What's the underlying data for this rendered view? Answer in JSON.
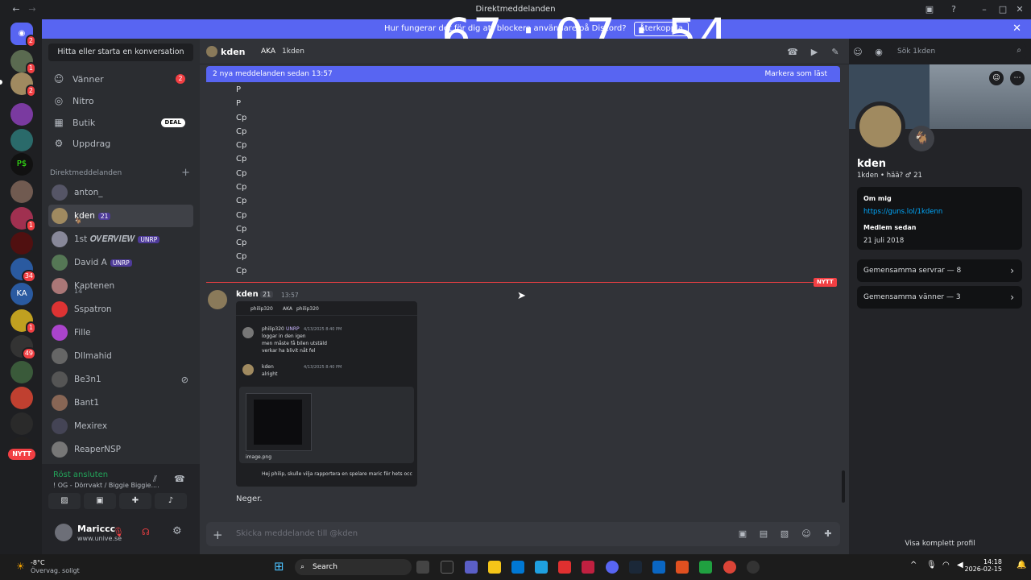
{
  "window": {
    "title": "Direktmeddelanden"
  },
  "overlay_clock": "67 : 07 : 54",
  "banner": {
    "text": "Hur fungerar det för dig att blockera användare på Discord?",
    "button": "Återkoppla"
  },
  "servers": {
    "badges": [
      "2",
      "1",
      "2",
      "1",
      "2",
      "34",
      "1",
      "49"
    ],
    "ka_label": "KA",
    "new_pill": "NYTT"
  },
  "dm_sidebar": {
    "search_placeholder": "Hitta eller starta en konversation",
    "nav": [
      {
        "label": "Vänner",
        "badge": "2"
      },
      {
        "label": "Nitro"
      },
      {
        "label": "Butik",
        "badge": "DEAL"
      },
      {
        "label": "Uppdrag"
      }
    ],
    "dm_header": "Direktmeddelanden",
    "dms": [
      {
        "name": "anton_"
      },
      {
        "name": "kden",
        "tag": "21",
        "sub": "🐐"
      },
      {
        "name": "1st 𝑶𝑽𝑬𝑹𝑽𝑰𝑬𝑾",
        "tag": "UNRP"
      },
      {
        "name": "David A",
        "tag": "UNRP"
      },
      {
        "name": "Kaptenen",
        "sub": "14"
      },
      {
        "name": "Sspatron"
      },
      {
        "name": "Fille"
      },
      {
        "name": "Dllmahid"
      },
      {
        "name": "Be3n1"
      },
      {
        "name": "Bant1"
      },
      {
        "name": "Mexirex"
      },
      {
        "name": "ReaperNSP"
      }
    ],
    "voice": {
      "status": "Röst ansluten",
      "channel": "! OG - Dörrvakt / Biggie Biggie...."
    },
    "user": {
      "name": "Mariccc",
      "status": "www.unive.se"
    }
  },
  "chat": {
    "header": {
      "name": "kden",
      "aka": "AKA",
      "handle": "1kden",
      "search_placeholder": "Sök 1kden"
    },
    "new_bar": {
      "text": "2 nya meddelanden sedan 13:57",
      "action": "Markera som läst"
    },
    "lines": [
      "P",
      "P",
      "Cp",
      "Cp",
      "Cp",
      "Cp",
      "Cp",
      "Cp",
      "Cp",
      "Cp",
      "Cp",
      "Cp",
      "Cp",
      "Cp"
    ],
    "new_label": "NYTT",
    "message": {
      "author": "kden",
      "tag": "21",
      "time": "13:57",
      "text": "Neger."
    },
    "screenshot": {
      "header_name": "philip320",
      "aka": "AKA",
      "handle": "philip320",
      "msg1_author": "philip320",
      "msg1_tag": "UNRP",
      "msg1_time": "4/13/2025 8:40 PM",
      "msg1_lines": [
        "loggar in den igen",
        "men måste få bilen utstäld",
        "verkar ha blivit nåt fel"
      ],
      "msg2_author": "kden",
      "msg2_time": "4/13/2025 8:40 PM",
      "msg2_text": "alright",
      "image_name": "image.png",
      "draft": "Hej philip, skulle vilja rapportera en spelare maric för hets occ"
    },
    "composer_placeholder": "Skicka meddelande till @kden"
  },
  "profile": {
    "display_name": "kden",
    "subline": "1kden • hää? ♂ 21",
    "about_header": "Om mig",
    "about_link": "https://guns.lol/1kdenn",
    "member_since_header": "Medlem sedan",
    "member_since": "21 juli 2018",
    "mutual_servers": "Gemensamma servrar — 8",
    "mutual_friends": "Gemensamma vänner — 3",
    "full_profile": "Visa komplett profil"
  },
  "taskbar": {
    "weather_temp": "-8°C",
    "weather_desc": "Övervag. soligt",
    "search": "Search",
    "time": "14:18",
    "date": "2026-02-15"
  },
  "colors": {
    "accent": "#5865f2",
    "alert": "#f23f43",
    "online": "#23a55a"
  }
}
